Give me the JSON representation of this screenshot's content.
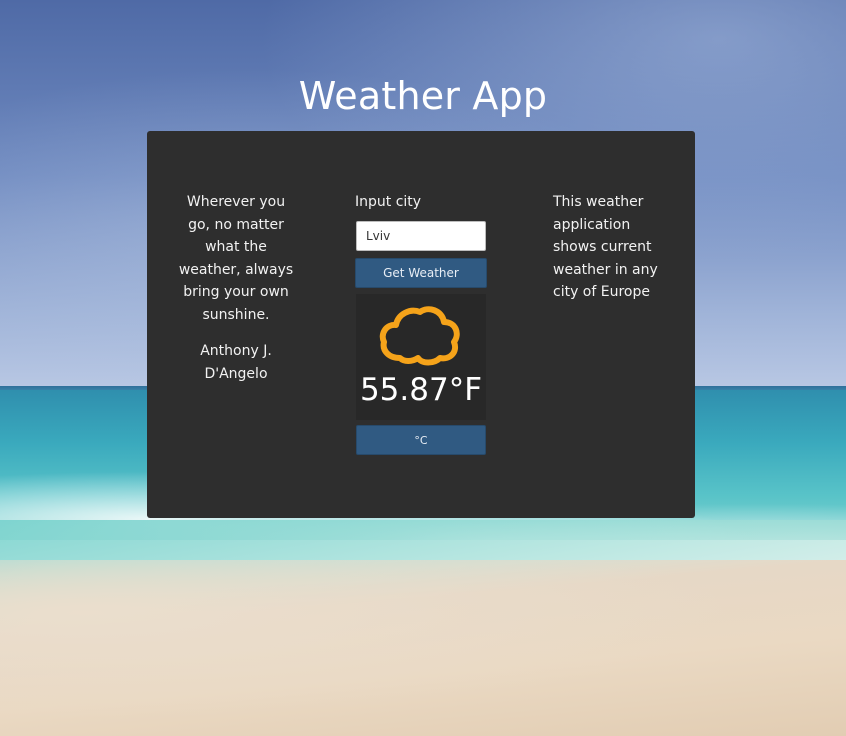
{
  "app": {
    "title": "Weather App"
  },
  "quote": {
    "text": "Wherever you go, no matter what the weather, always bring your own sunshine.",
    "author": "Anthony J. D'Angelo"
  },
  "form": {
    "label": "Input city",
    "city_value": "Lviv",
    "submit_label": "Get Weather"
  },
  "weather": {
    "icon": "cloud-icon",
    "icon_color": "#f5a31a",
    "temperature": "55.87°F",
    "unit_toggle_label": "°C"
  },
  "info": {
    "text": "This weather application shows current weather in any city of Europe"
  },
  "colors": {
    "panel": "#2e2e2e",
    "button": "#305a82"
  }
}
